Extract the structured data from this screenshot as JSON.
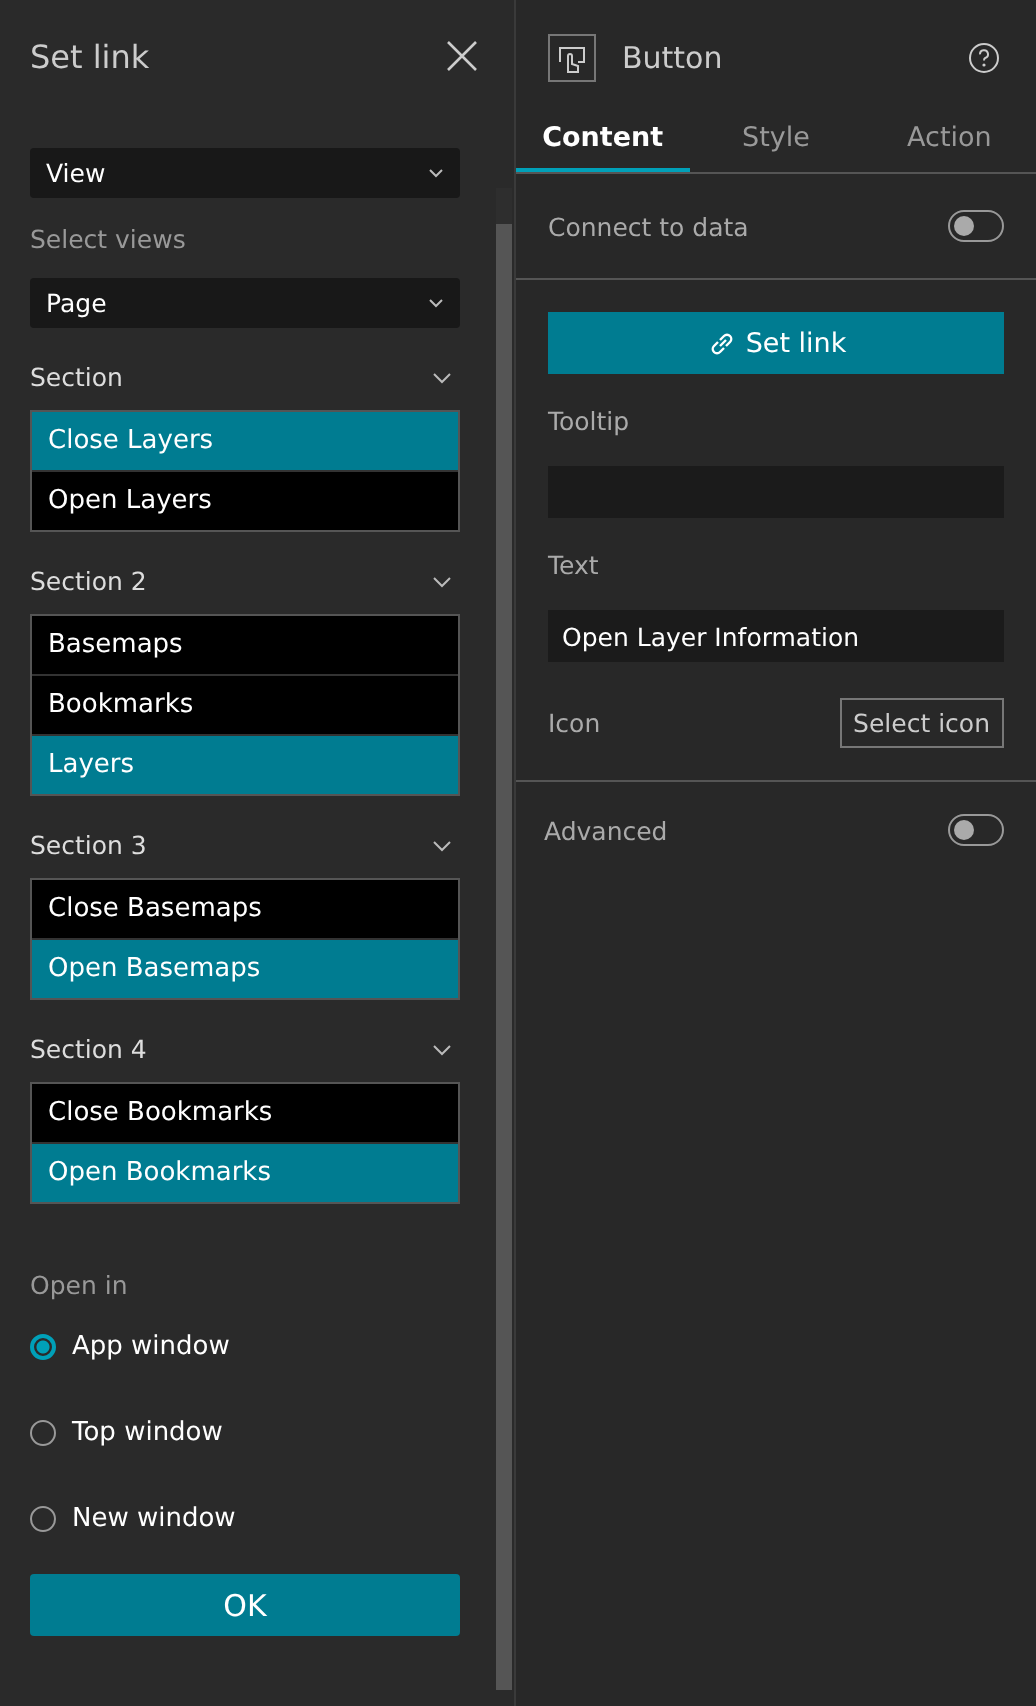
{
  "dialog": {
    "title": "Set link",
    "link_type": {
      "value": "View"
    },
    "views_label": "Select views",
    "views": {
      "value": "Page"
    },
    "sections": [
      {
        "title": "Section",
        "expanded": true,
        "items": [
          {
            "label": "Close Layers",
            "selected": true
          },
          {
            "label": "Open Layers",
            "selected": false
          }
        ]
      },
      {
        "title": "Section 2",
        "expanded": true,
        "items": [
          {
            "label": "Basemaps",
            "selected": false
          },
          {
            "label": "Bookmarks",
            "selected": false
          },
          {
            "label": "Layers",
            "selected": true
          }
        ]
      },
      {
        "title": "Section 3",
        "expanded": true,
        "items": [
          {
            "label": "Close Basemaps",
            "selected": false
          },
          {
            "label": "Open Basemaps",
            "selected": true
          }
        ]
      },
      {
        "title": "Section 4",
        "expanded": true,
        "items": [
          {
            "label": "Close Bookmarks",
            "selected": false
          },
          {
            "label": "Open Bookmarks",
            "selected": true
          }
        ]
      }
    ],
    "open_in_label": "Open in",
    "open_in": [
      {
        "label": "App window",
        "selected": true
      },
      {
        "label": "Top window",
        "selected": false
      },
      {
        "label": "New window",
        "selected": false
      }
    ],
    "ok": "OK"
  },
  "panel": {
    "title": "Button",
    "tabs": [
      {
        "label": "Content",
        "selected": true
      },
      {
        "label": "Style",
        "selected": false
      },
      {
        "label": "Action",
        "selected": false
      }
    ],
    "connect": {
      "label": "Connect to data",
      "on": false
    },
    "set_link": "Set link",
    "tooltip": {
      "label": "Tooltip"
    },
    "text": {
      "label": "Text",
      "value": "Open Layer Information"
    },
    "icon": {
      "label": "Icon",
      "button": "Select icon"
    },
    "advanced": {
      "label": "Advanced",
      "on": false
    }
  }
}
